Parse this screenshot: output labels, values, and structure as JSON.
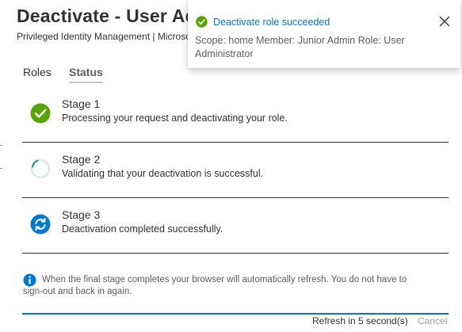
{
  "panel": {
    "title": "Deactivate - User Administrator",
    "subtitle": "Privileged Identity Management | Microsoft Azure AD roles"
  },
  "tabs": [
    {
      "label": "Roles",
      "selected": false
    },
    {
      "label": "Status",
      "selected": true
    }
  ],
  "stages": [
    {
      "name": "Stage 1",
      "description": "Processing your request and deactivating your role.",
      "state": "complete",
      "icon": "checkmark-circle-icon"
    },
    {
      "name": "Stage 2",
      "description": "Validating that your deactivation is successful.",
      "state": "in-progress",
      "icon": "spinner-icon"
    },
    {
      "name": "Stage 3",
      "description": "Deactivation completed successfully.",
      "state": "refresh",
      "icon": "sync-circle-icon"
    }
  ],
  "info": {
    "icon": "info-icon",
    "line1": "When the final stage completes your browser will automatically refresh. You do not have to",
    "line2": "sign-out and back in again."
  },
  "footer": {
    "refresh_text": "Refresh in 5 second(s)",
    "cancel_label": "Cancel"
  },
  "toast": {
    "icon": "success-check-icon",
    "title": "Deactivate role succeeded",
    "message": "Scope: home Member: Junior Admin Role: User Administrator",
    "close_icon": "close-icon"
  },
  "colors": {
    "accent": "#0078d4",
    "success": "#57a300",
    "text": "#323130",
    "muted": "#605e5c"
  }
}
